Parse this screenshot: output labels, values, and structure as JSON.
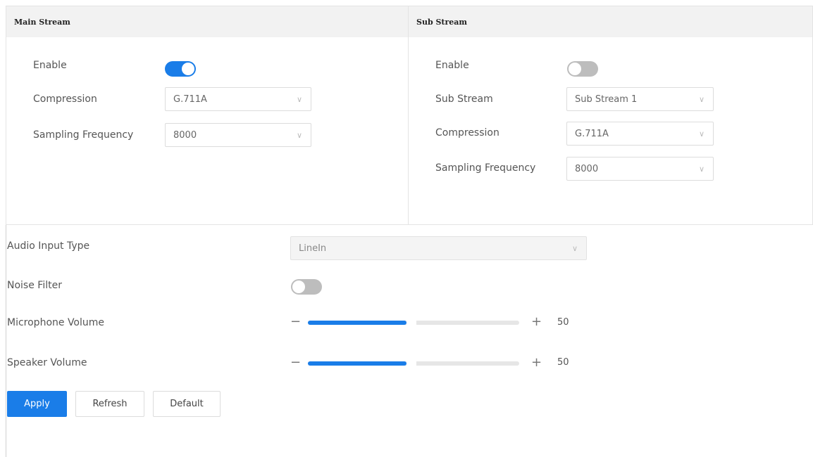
{
  "main_stream": {
    "title": "Main Stream",
    "enable_label": "Enable",
    "enable_on": true,
    "compression_label": "Compression",
    "compression_value": "G.711A",
    "sampling_label": "Sampling Frequency",
    "sampling_value": "8000"
  },
  "sub_stream": {
    "title": "Sub Stream",
    "enable_label": "Enable",
    "enable_on": false,
    "substream_label": "Sub Stream",
    "substream_value": "Sub Stream 1",
    "compression_label": "Compression",
    "compression_value": "G.711A",
    "sampling_label": "Sampling Frequency",
    "sampling_value": "8000"
  },
  "audio_input": {
    "label": "Audio Input Type",
    "value": "LineIn"
  },
  "noise_filter": {
    "label": "Noise Filter",
    "on": false
  },
  "microphone_volume": {
    "label": "Microphone Volume",
    "minus": "−",
    "plus": "+",
    "value": "50",
    "level": 0.5
  },
  "speaker_volume": {
    "label": "Speaker Volume",
    "minus": "−",
    "plus": "+",
    "value": "50",
    "level": 0.5
  },
  "buttons": {
    "apply": "Apply",
    "refresh": "Refresh",
    "default": "Default"
  },
  "colors": {
    "accent": "#1a7de8",
    "toggle_off": "#bdbdbd"
  }
}
